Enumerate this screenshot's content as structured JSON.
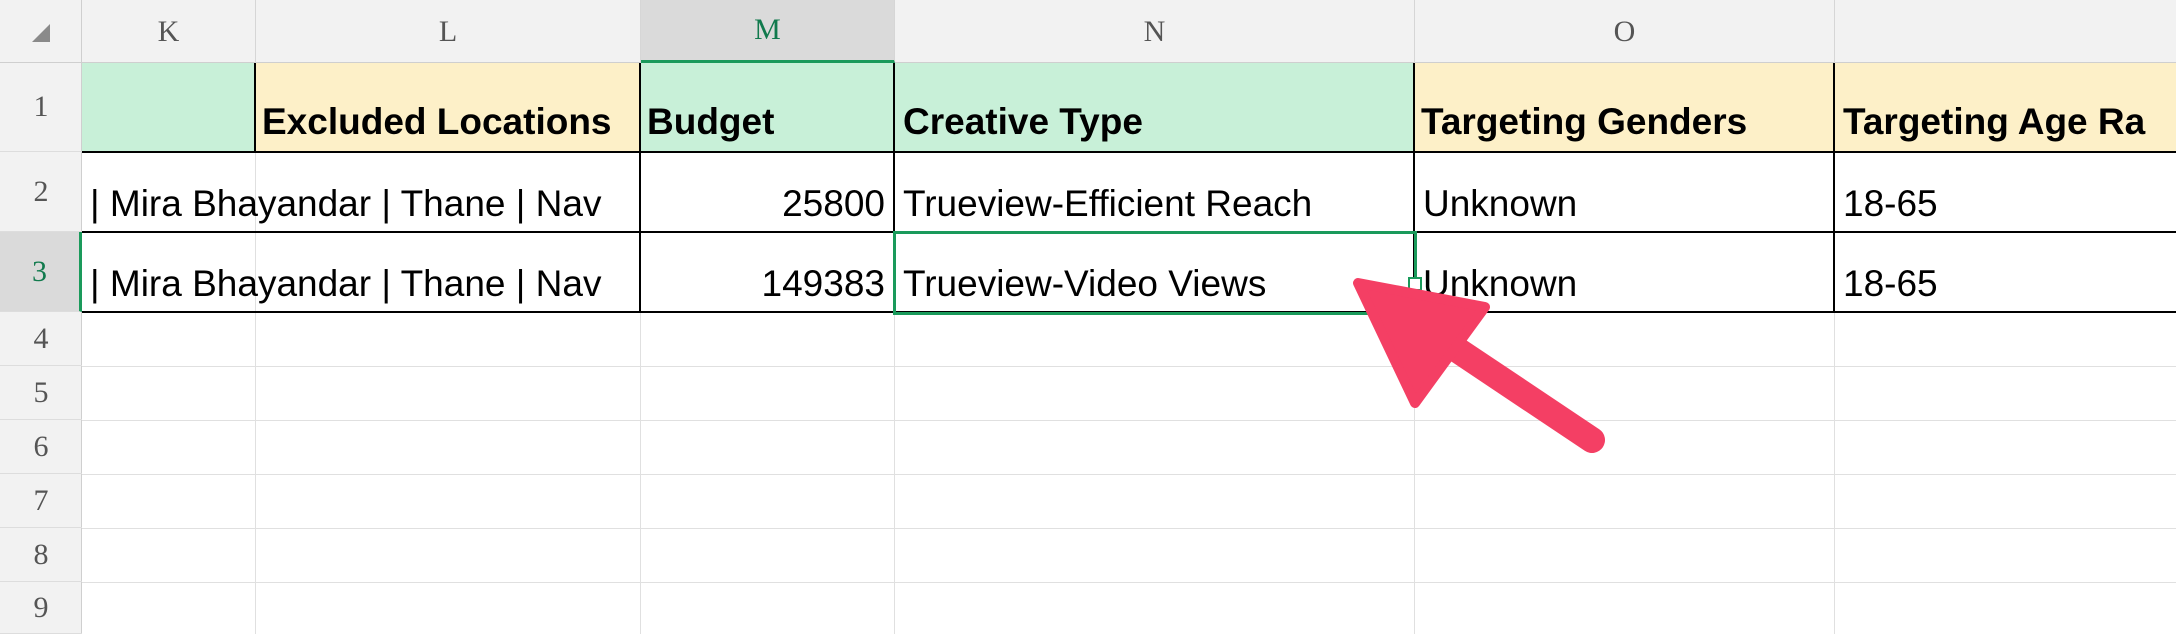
{
  "columns": [
    "K",
    "L",
    "M",
    "N",
    "O"
  ],
  "rows": [
    "1",
    "2",
    "3",
    "4",
    "5",
    "6",
    "7",
    "8",
    "9"
  ],
  "header_row": {
    "k": "",
    "k2": "Excluded Locations",
    "l": "Budget",
    "m": "Creative Type",
    "n": "Targeting Genders",
    "o": "Targeting Age Ra"
  },
  "data_rows": [
    {
      "k": "| Mira Bhayandar | Thane | Nav",
      "l": "25800",
      "m": "Trueview-Efficient Reach",
      "n": "Unknown",
      "o": "18-65"
    },
    {
      "k": "| Mira Bhayandar | Thane | Nav",
      "l": "149383",
      "m": "Trueview-Video Views",
      "n": "Unknown",
      "o": "18-65"
    }
  ],
  "selected_cell": "M3",
  "annotation": {
    "type": "arrow",
    "color": "#f43f64"
  },
  "colors": {
    "header_green": "#c8f0d8",
    "header_yellow": "#fdf0c8",
    "selection": "#1a9a5b"
  }
}
